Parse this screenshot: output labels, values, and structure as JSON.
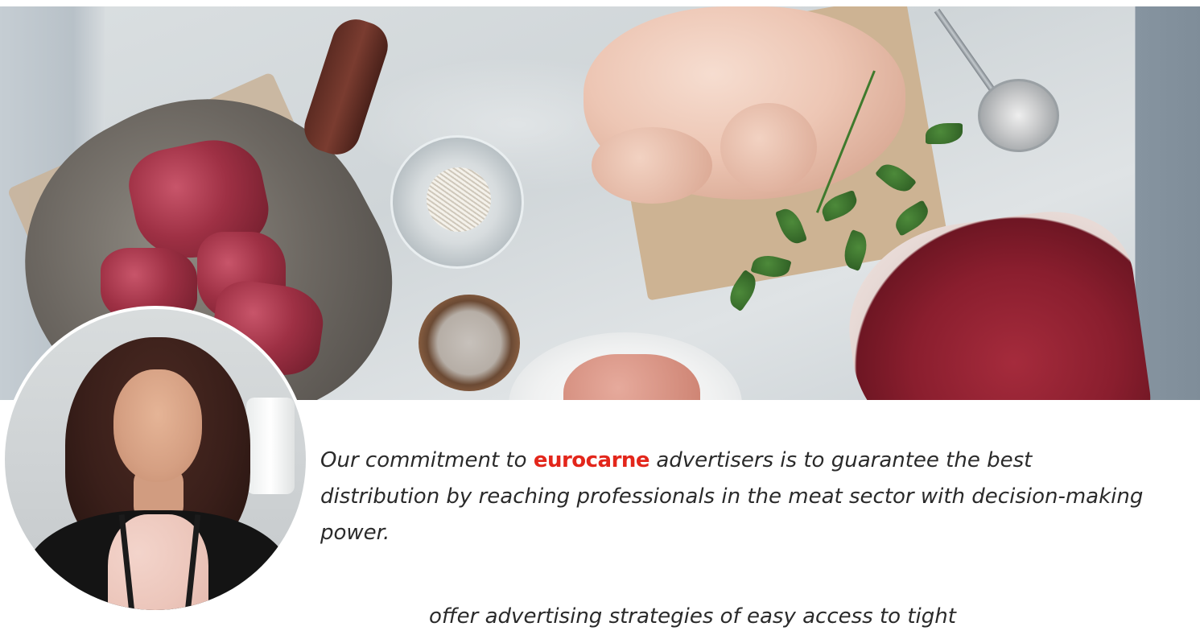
{
  "quote": {
    "before_brand": "Our commitment to ",
    "brand": "eurocarne",
    "after_brand": " advertisers is to guarantee the best distribution by reaching professionals in the meat sector with decision-making power.",
    "continuation_partial": "offer advertising strategies of easy access to tight"
  },
  "colors": {
    "brand_red": "#e3261b",
    "text": "#2a2a2a"
  }
}
